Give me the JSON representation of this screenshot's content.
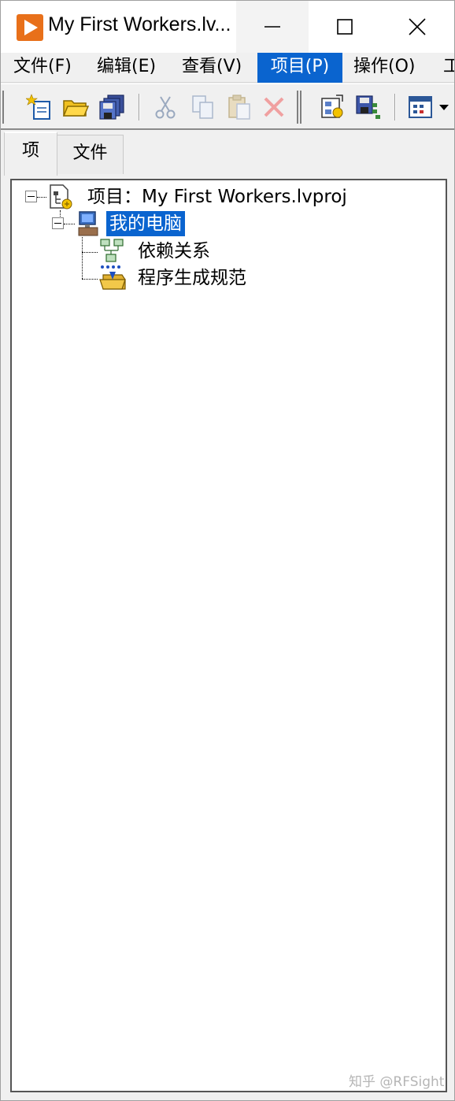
{
  "window": {
    "title": "My First Workers.lv...",
    "controls": {
      "minimize": "minimize",
      "maximize": "maximize",
      "close": "close"
    }
  },
  "menu": {
    "items": [
      {
        "label": "文件(F)"
      },
      {
        "label": "编辑(E)"
      },
      {
        "label": "查看(V)"
      },
      {
        "label": "项目(P)",
        "active": true
      },
      {
        "label": "操作(O)"
      },
      {
        "label": "工"
      }
    ]
  },
  "toolbar": {
    "buttons": [
      "new-icon",
      "open-folder-icon",
      "save-all-icon",
      "cut-icon",
      "copy-icon",
      "paste-icon",
      "delete-icon",
      "project-properties-icon",
      "save-project-icon",
      "view-options-icon"
    ]
  },
  "tabs": [
    {
      "label": "项",
      "selected": true
    },
    {
      "label": "文件",
      "selected": false
    }
  ],
  "tree": {
    "root": {
      "label": "项目：My First Workers.lvproj",
      "icon": "project-icon"
    },
    "computer": {
      "label": "我的电脑",
      "icon": "computer-icon",
      "selected": true
    },
    "children": [
      {
        "label": "依赖关系",
        "icon": "dependencies-icon"
      },
      {
        "label": "程序生成规范",
        "icon": "build-specifications-icon"
      }
    ]
  },
  "watermark": "知乎 @RFSight",
  "colors": {
    "selection": "#0a64cf",
    "app_icon": "#e8701a"
  }
}
